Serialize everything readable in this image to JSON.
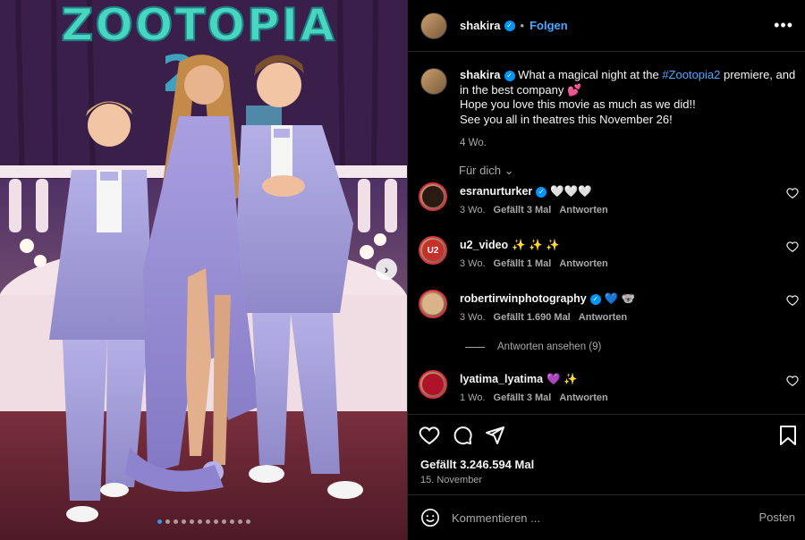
{
  "photo": {
    "title_art": "ZOOTOPIA",
    "slides_count": 12,
    "active_slide": 1
  },
  "post": {
    "author": "shakira",
    "follow_label": "Folgen",
    "separator": "•",
    "caption": {
      "text_before_tag": "What a magical night at the ",
      "hashtag": "#Zootopia2",
      "text_after_tag": " premiere, and in the best company",
      "emoji": "💕",
      "line2": "Hope you love this movie as much as we did!!",
      "line3": "See you all in theatres this November 26!"
    },
    "caption_time": "4 Wo.",
    "for_you_label": "Für dich",
    "likes": "Gefällt 3.246.594 Mal",
    "date": "15. November"
  },
  "comments": [
    {
      "user": "esranurturker",
      "verified": true,
      "text": "🤍🤍🤍",
      "time": "3 Wo.",
      "likes": "Gefällt 3 Mal",
      "reply": "Antworten",
      "avatar_color": "#2b1a12"
    },
    {
      "user": "u2_video",
      "verified": false,
      "text": "✨ ✨ ✨",
      "time": "3 Wo.",
      "likes": "Gefällt 1 Mal",
      "reply": "Antworten",
      "avatar_color": "#c4302b",
      "avatar_text": "U2"
    },
    {
      "user": "robertirwinphotography",
      "verified": true,
      "text": "💙 🐨",
      "time": "3 Wo.",
      "likes": "Gefällt 1.690 Mal",
      "reply": "Antworten",
      "avatar_color": "#d9b48a"
    },
    {
      "user": "lyatima_lyatima",
      "verified": false,
      "text": "💜 ✨",
      "time": "1 Wo.",
      "likes": "Gefällt 3 Mal",
      "reply": "Antworten",
      "avatar_color": "#b0122a"
    }
  ],
  "view_replies": "Antworten ansehen (9)",
  "composer": {
    "placeholder": "Kommentieren ...",
    "post_label": "Posten"
  },
  "colors": {
    "accent": "#0095f6",
    "link": "#4aa8ff",
    "muted": "#a8a8a8",
    "background": "#000000"
  }
}
